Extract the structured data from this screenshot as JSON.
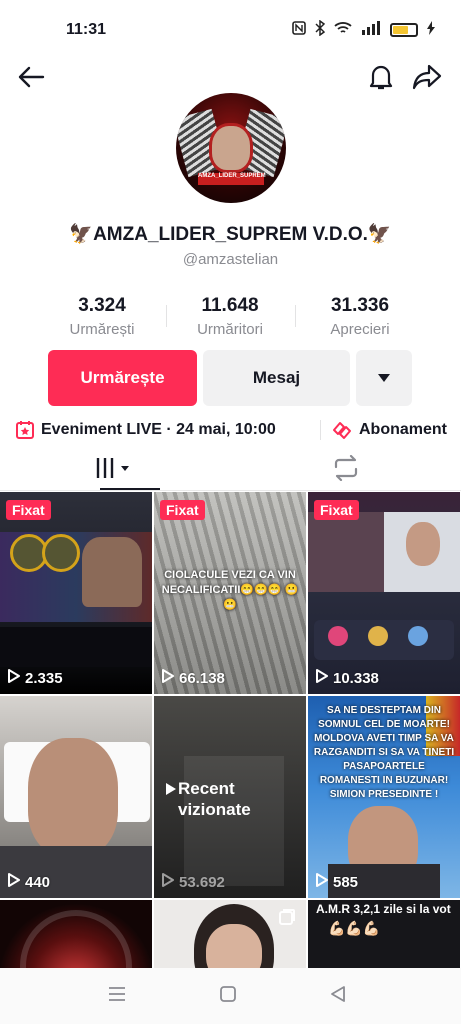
{
  "status_bar": {
    "time": "11:31",
    "icons": [
      "nfc-icon",
      "bluetooth-icon",
      "wifi-icon",
      "signal-icon",
      "battery-icon",
      "charging-icon"
    ]
  },
  "profile": {
    "display_name": "🦅AMZA_LIDER_SUPREM V.D.O.🦅",
    "username": "@amzastelian",
    "avatar_banner": "AMZA_LIDER_SUPREM",
    "stats": [
      {
        "value": "3.324",
        "label": "Urmărești"
      },
      {
        "value": "11.648",
        "label": "Urmăritori"
      },
      {
        "value": "31.336",
        "label": "Aprecieri"
      }
    ]
  },
  "actions": {
    "follow_label": "Urmărește",
    "message_label": "Mesaj"
  },
  "info": {
    "live_event": "Eveniment LIVE · 24 mai, 10:00",
    "subscription": "Abonament"
  },
  "grid": {
    "videos": [
      {
        "views": "2.335",
        "pinned": "Fixat"
      },
      {
        "views": "66.138",
        "pinned": "Fixat",
        "caption": "CIOLACULE VEZI CA VIN NECALIFICATII😁😁😁 😬😬"
      },
      {
        "views": "10.338",
        "pinned": "Fixat"
      },
      {
        "views": "440"
      },
      {
        "views": "53.692",
        "overlay": "Recent vizionate"
      },
      {
        "views": "585",
        "caption": "SA NE DESTEPTAM DIN SOMNUL CEL DE MOARTE! MOLDOVA AVETI TIMP SA VA RAZGANDITI SI SA VA TINETI PASAPOARTELE ROMANESTI IN BUZUNAR! SIMION PRESEDINTE !"
      },
      {},
      {},
      {
        "caption": "A.M.R 3,2,1 zile si la vot"
      }
    ]
  },
  "colors": {
    "accent": "#fe2c55",
    "secondary_button": "#f1f1f2",
    "muted_text": "#8a8b91"
  }
}
